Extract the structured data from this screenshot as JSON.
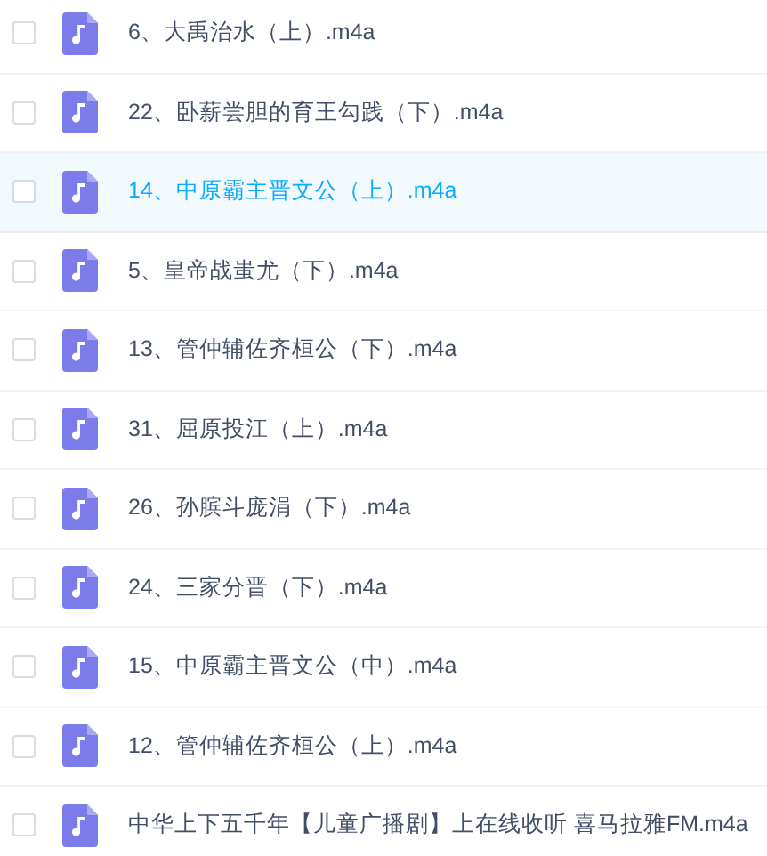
{
  "files": [
    {
      "name": "6、大禹治水（上）.m4a",
      "selected": false,
      "checked": false
    },
    {
      "name": "22、卧薪尝胆的育王勾践（下）.m4a",
      "selected": false,
      "checked": false
    },
    {
      "name": "14、中原霸主晋文公（上）.m4a",
      "selected": true,
      "checked": false
    },
    {
      "name": "5、皇帝战蚩尤（下）.m4a",
      "selected": false,
      "checked": false
    },
    {
      "name": "13、管仲辅佐齐桓公（下）.m4a",
      "selected": false,
      "checked": false
    },
    {
      "name": "31、屈原投江（上）.m4a",
      "selected": false,
      "checked": false
    },
    {
      "name": "26、孙膑斗庞涓（下）.m4a",
      "selected": false,
      "checked": false
    },
    {
      "name": "24、三家分晋（下）.m4a",
      "selected": false,
      "checked": false
    },
    {
      "name": "15、中原霸主晋文公（中）.m4a",
      "selected": false,
      "checked": false
    },
    {
      "name": "12、管仲辅佐齐桓公（上）.m4a",
      "selected": false,
      "checked": false
    },
    {
      "name": "中华上下五千年【儿童广播剧】上在线收听 喜马拉雅FM.m4a",
      "selected": false,
      "checked": false
    }
  ]
}
